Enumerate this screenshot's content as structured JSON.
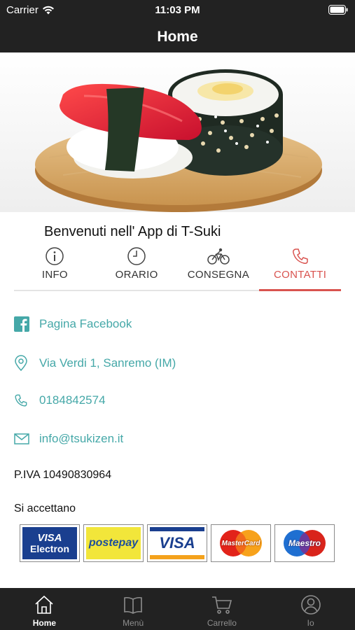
{
  "status_bar": {
    "carrier": "Carrier",
    "time": "11:03 PM"
  },
  "nav": {
    "title": "Home"
  },
  "carousel": {
    "page_count": 4,
    "active_index": 2
  },
  "welcome": "Benvenuti nell' App di T-Suki",
  "tabs": [
    {
      "label": "INFO",
      "icon": "info-icon",
      "active": false
    },
    {
      "label": "ORARIO",
      "icon": "clock-icon",
      "active": false
    },
    {
      "label": "CONSEGNA",
      "icon": "bicycle-icon",
      "active": false
    },
    {
      "label": "CONTATTI",
      "icon": "phone-icon",
      "active": true
    }
  ],
  "contacts": {
    "facebook": "Pagina Facebook",
    "address": "Via Verdi 1, Sanremo (IM)",
    "phone": "0184842574",
    "email": "info@tsukizen.it"
  },
  "piva": "P.IVA 10490830964",
  "accept_label": "Si accettano",
  "payment_cards": {
    "visa_electron": {
      "top": "VISA",
      "bottom": "Electron"
    },
    "postepay": "postepay",
    "visa": "VISA",
    "mastercard": "MasterCard",
    "maestro": "Maestro"
  },
  "bottom_tabs": [
    {
      "label": "Home",
      "icon": "home-icon",
      "active": true
    },
    {
      "label": "Menù",
      "icon": "book-icon",
      "active": false
    },
    {
      "label": "Carrello",
      "icon": "cart-icon",
      "active": false
    },
    {
      "label": "Io",
      "icon": "user-icon",
      "active": false
    }
  ],
  "colors": {
    "accent": "#d9534f",
    "link": "#45a8a8",
    "bar": "#222222",
    "dot_active": "#1e7fe0"
  }
}
